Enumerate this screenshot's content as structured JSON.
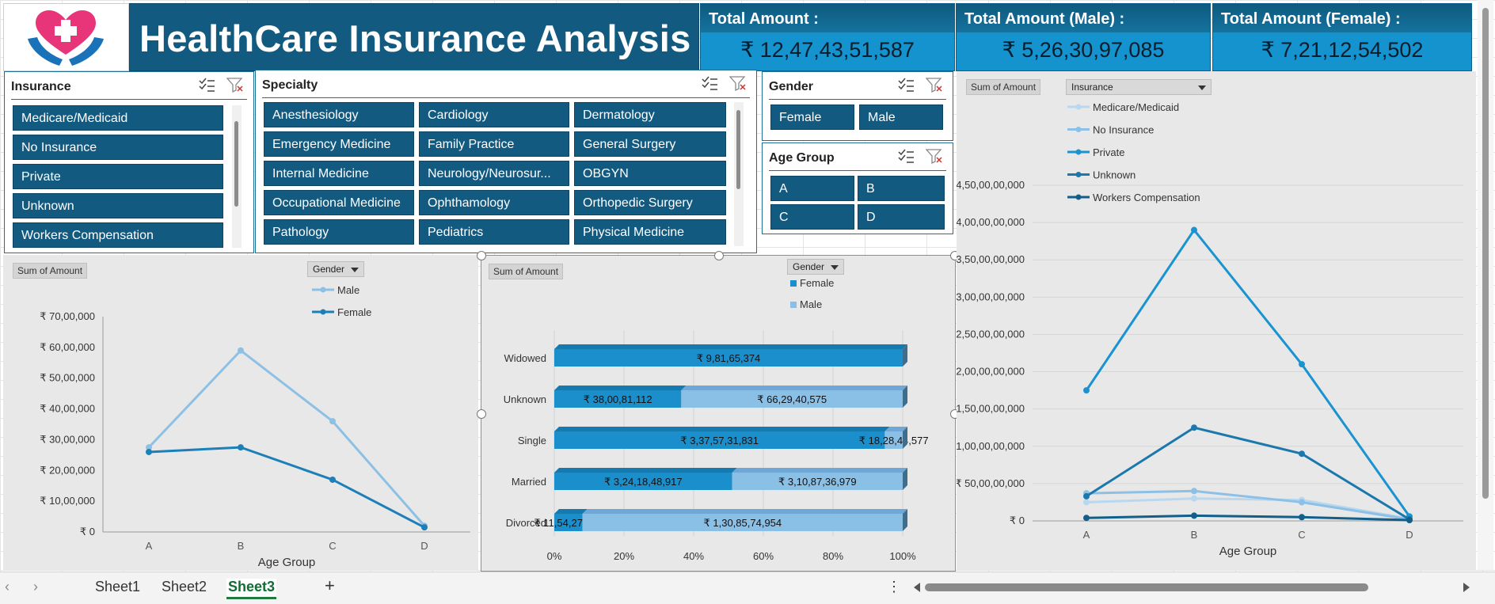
{
  "header": {
    "title": "HealthCare Insurance Analysis",
    "kpis": [
      {
        "label": "Total Amount :",
        "value": "₹ 12,47,43,51,587"
      },
      {
        "label": "Total Amount (Male) :",
        "value": "₹ 5,26,30,97,085"
      },
      {
        "label": "Total Amount (Female) :",
        "value": "₹ 7,21,12,54,502"
      }
    ]
  },
  "slicers": {
    "insurance": {
      "title": "Insurance",
      "items": [
        "Medicare/Medicaid",
        "No Insurance",
        "Private",
        "Unknown",
        "Workers Compensation"
      ]
    },
    "specialty": {
      "title": "Specialty",
      "items": [
        "Anesthesiology",
        "Cardiology",
        "Dermatology",
        "Emergency Medicine",
        "Family Practice",
        "General Surgery",
        "Internal Medicine",
        "Neurology/Neurosur...",
        "OBGYN",
        "Occupational Medicine",
        "Ophthamology",
        "Orthopedic Surgery",
        "Pathology",
        "Pediatrics",
        "Physical Medicine"
      ]
    },
    "gender": {
      "title": "Gender",
      "items": [
        "Female",
        "Male"
      ]
    },
    "age_group": {
      "title": "Age Group",
      "items": [
        "A",
        "B",
        "C",
        "D"
      ]
    }
  },
  "chart_data": [
    {
      "type": "line",
      "field_button": "Sum of Amount",
      "legend_dropdown": "Gender",
      "xlabel": "Age Group",
      "x": [
        "A",
        "B",
        "C",
        "D"
      ],
      "yticks": [
        "₹ 0",
        "₹ 10,00,000",
        "₹ 20,00,000",
        "₹ 30,00,000",
        "₹ 40,00,000",
        "₹ 50,00,000",
        "₹ 60,00,000",
        "₹ 70,00,000"
      ],
      "ylim": [
        0,
        7000000
      ],
      "series": [
        {
          "name": "Male",
          "color": "#8cc0e4",
          "values": [
            2750000,
            5900000,
            3600000,
            200000
          ]
        },
        {
          "name": "Female",
          "color": "#1d7fb8",
          "values": [
            2600000,
            2750000,
            1700000,
            150000
          ]
        }
      ]
    },
    {
      "type": "bar",
      "stacked_percent": true,
      "field_button": "Sum of Amount",
      "legend_dropdown": "Gender",
      "categories": [
        "Widowed",
        "Unknown",
        "Single",
        "Married",
        "Divorced"
      ],
      "xticks": [
        "0%",
        "20%",
        "40%",
        "60%",
        "80%",
        "100%"
      ],
      "series": [
        {
          "name": "Female",
          "color": "#1a8fcc",
          "values": [
            98165374,
            3800811112,
            33757318311,
            32418489170,
            1154273268
          ],
          "labels": [
            "₹ 9,81,65,374",
            "₹ 38,00,81,112",
            "₹ 3,37,57,31,831",
            "₹ 3,24,18,48,917",
            "₹ 11,54,27,268"
          ]
        },
        {
          "name": "Male",
          "color": "#8abfe6",
          "values": [
            0,
            6629405750,
            1828445770,
            31087369790,
            13085749540
          ],
          "labels": [
            "",
            "₹ 66,29,40,575",
            "₹ 18,28,44,577",
            "₹ 3,10,87,36,979",
            "₹ 1,30,85,74,954"
          ]
        }
      ]
    },
    {
      "type": "line",
      "field_button": "Sum of Amount",
      "legend_dropdown": "Insurance",
      "xlabel": "Age Group",
      "x": [
        "A",
        "B",
        "C",
        "D"
      ],
      "yticks": [
        "₹ 0",
        "₹ 50,00,00,000",
        "₹ 1,00,00,00,000",
        "₹ 1,50,00,00,000",
        "₹ 2,00,00,00,000",
        "₹ 2,50,00,00,000",
        "₹ 3,00,00,00,000",
        "₹ 3,50,00,00,000",
        "₹ 4,00,00,00,000",
        "₹ 4,50,00,00,000"
      ],
      "ylim": [
        0,
        4500000000
      ],
      "series": [
        {
          "name": "Medicare/Medicaid",
          "color": "#b9d8ef",
          "values": [
            250000000,
            300000000,
            280000000,
            30000000
          ]
        },
        {
          "name": "No Insurance",
          "color": "#8cc0e6",
          "values": [
            370000000,
            400000000,
            250000000,
            20000000
          ]
        },
        {
          "name": "Private",
          "color": "#1a93d0",
          "values": [
            1750000000,
            3900000000,
            2100000000,
            60000000
          ]
        },
        {
          "name": "Unknown",
          "color": "#1a78ad",
          "values": [
            330000000,
            1250000000,
            900000000,
            20000000
          ]
        },
        {
          "name": "Workers Compensation",
          "color": "#125f8a",
          "values": [
            40000000,
            70000000,
            50000000,
            10000000
          ]
        }
      ]
    }
  ],
  "sheet_tabs": [
    "Sheet1",
    "Sheet2",
    "Sheet3"
  ],
  "active_tab": "Sheet3",
  "add_sheet": "+",
  "more": "⋮",
  "nav": {
    "prev": "‹",
    "next": "›"
  }
}
